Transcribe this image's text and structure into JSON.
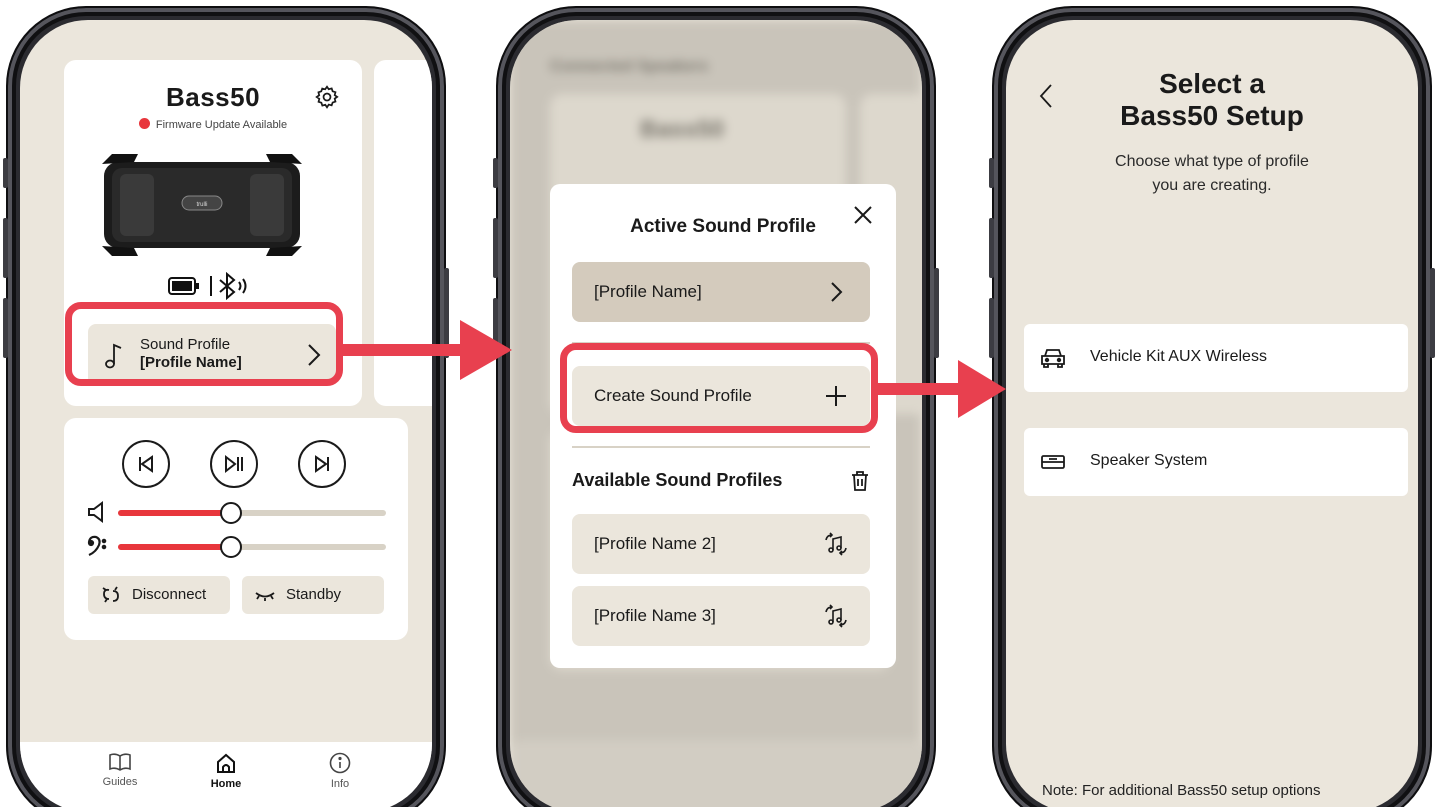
{
  "colors": {
    "accent": "#e8404f",
    "beige": "#ebe6dc",
    "dark_beige": "#d4cbbd",
    "status_red": "#e8363c"
  },
  "screen1": {
    "speaker_name": "Bass50",
    "firmware_status": "Firmware Update Available",
    "sound_profile_label": "Sound Profile",
    "sound_profile_value": "[Profile Name]",
    "volume_level": 0.42,
    "bass_level": 0.42,
    "disconnect_label": "Disconnect",
    "standby_label": "Standby",
    "tabs": [
      {
        "label": "Guides",
        "icon": "book-icon"
      },
      {
        "label": "Home",
        "icon": "home-icon"
      },
      {
        "label": "Info",
        "icon": "info-icon"
      }
    ]
  },
  "screen2": {
    "bg_header": "Connected Speakers",
    "bg_speaker": "Bass50",
    "active_title": "Active Sound Profile",
    "active_profile": "[Profile Name]",
    "create_label": "Create Sound Profile",
    "available_title": "Available Sound Profiles",
    "available_profiles": [
      "[Profile Name 2]",
      "[Profile Name 3]"
    ]
  },
  "screen3": {
    "title_line1": "Select a",
    "title_line2": "Bass50 Setup",
    "subtitle_line1": "Choose what type of profile",
    "subtitle_line2": "you are creating.",
    "options": [
      {
        "label": "Vehicle Kit AUX Wireless",
        "icon": "car-icon"
      },
      {
        "label": "Speaker System",
        "icon": "speaker-icon"
      }
    ],
    "note": "Note: For additional Bass50 setup options"
  }
}
